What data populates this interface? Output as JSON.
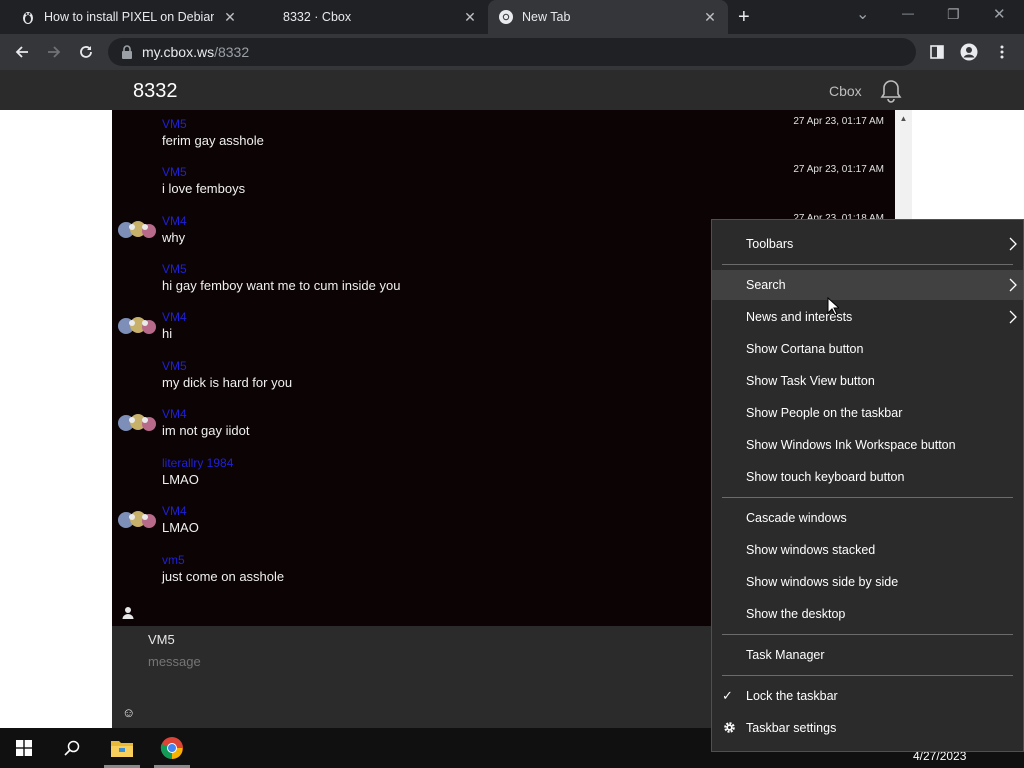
{
  "browser": {
    "tabs": [
      {
        "title": "How to install PIXEL on Debian B",
        "active": false
      },
      {
        "title": "8332 · Cbox",
        "active": false
      },
      {
        "title": "New Tab",
        "active": true
      }
    ],
    "close_glyph": "✕",
    "new_tab_glyph": "+",
    "window_controls": {
      "dropdown": "⌄",
      "minimize": "—",
      "restore": "❐",
      "close": "✕"
    },
    "url_host": "my.cbox.ws",
    "url_path": "/8332"
  },
  "site": {
    "title": "8332",
    "brand": "Cbox"
  },
  "chat": {
    "messages": [
      {
        "nick": "VM5",
        "text": "ferim gay asshole",
        "time": "27 Apr 23, 01:17 AM",
        "avatar": false
      },
      {
        "nick": "VM5",
        "text": "i love femboys",
        "time": "27 Apr 23, 01:17 AM",
        "avatar": false
      },
      {
        "nick": "VM4",
        "text": "why",
        "time": "27 Apr 23, 01:18 AM",
        "avatar": true
      },
      {
        "nick": "VM5",
        "text": "hi gay femboy want me to cum inside you",
        "time": "",
        "avatar": false
      },
      {
        "nick": "VM4",
        "text": "hi",
        "time": "",
        "avatar": true
      },
      {
        "nick": "VM5",
        "text": "my dick is hard for you",
        "time": "",
        "avatar": false
      },
      {
        "nick": "VM4",
        "text": "im not gay iidot",
        "time": "",
        "avatar": true
      },
      {
        "nick": "literallry 1984",
        "text": "LMAO",
        "time": "",
        "avatar": false
      },
      {
        "nick": "VM4",
        "text": "LMAO",
        "time": "",
        "avatar": true
      },
      {
        "nick": "vm5",
        "text": "just come on asshole",
        "time": "",
        "avatar": false
      }
    ],
    "scroll_up_glyph": "▲",
    "compose_name": "VM5",
    "compose_placeholder": "message",
    "emoji_glyph": "☺"
  },
  "taskbar": {
    "date": "4/27/2023",
    "chevron": "⌄"
  },
  "context_menu": {
    "items": [
      {
        "label": "Toolbars",
        "submenu": true
      },
      {
        "label": "Search",
        "submenu": true,
        "hover": true
      },
      {
        "label": "News and interests",
        "submenu": true
      },
      {
        "label": "Show Cortana button"
      },
      {
        "label": "Show Task View button"
      },
      {
        "label": "Show People on the taskbar"
      },
      {
        "label": "Show Windows Ink Workspace button"
      },
      {
        "label": "Show touch keyboard button"
      },
      {
        "label": "Cascade windows"
      },
      {
        "label": "Show windows stacked"
      },
      {
        "label": "Show windows side by side"
      },
      {
        "label": "Show the desktop"
      },
      {
        "label": "Task Manager"
      },
      {
        "label": "Lock the taskbar",
        "checked": true
      },
      {
        "label": "Taskbar settings",
        "icon": "gear-icon"
      }
    ],
    "check_glyph": "✓"
  }
}
